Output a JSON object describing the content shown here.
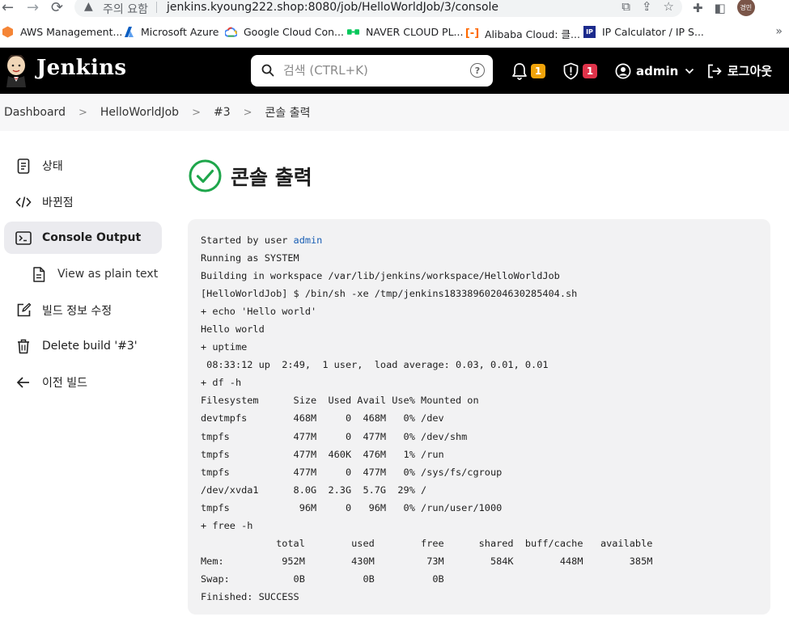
{
  "browser": {
    "security_status": "주의 요함",
    "url": "jenkins.kyoung222.shop:8080/job/HelloWorldJob/3/console",
    "profile_initials": "경민",
    "bookmarks": [
      {
        "label": "AWS Management...",
        "icon": "aws-cube-icon",
        "color": "#f58536"
      },
      {
        "label": "Microsoft Azure",
        "icon": "azure-icon",
        "color": "#0078d4"
      },
      {
        "label": "Google Cloud Con...",
        "icon": "google-cloud-icon",
        "color": "#4285f4"
      },
      {
        "label": "NAVER CLOUD PL...",
        "icon": "naver-cloud-icon",
        "color": "#03c75a"
      },
      {
        "label": "Alibaba Cloud: 클...",
        "icon": "alibaba-icon",
        "color": "#ff6a00"
      },
      {
        "label": "IP Calculator / IP S...",
        "icon": "ip-calculator-icon",
        "color": "#1b2a8c"
      }
    ],
    "more": "»"
  },
  "header": {
    "title": "Jenkins",
    "search_placeholder": "검색 (CTRL+K)",
    "notifications_count": "1",
    "security_count": "1",
    "user": "admin",
    "logout_label": "로그아웃",
    "colors": {
      "notification_badge": "#f0a30a",
      "security_badge": "#e0334a"
    }
  },
  "breadcrumb": [
    "Dashboard",
    "HelloWorldJob",
    "#3",
    "콘솔 출력"
  ],
  "sidebar": {
    "items": [
      {
        "label": "상태",
        "icon": "status-document-icon"
      },
      {
        "label": "바뀐점",
        "icon": "code-changes-icon"
      },
      {
        "label": "Console Output",
        "icon": "terminal-icon",
        "active": true
      },
      {
        "label": "View as plain text",
        "icon": "plain-text-document-icon",
        "sub": true
      },
      {
        "label": "빌드 정보 수정",
        "icon": "edit-icon"
      },
      {
        "label": "Delete build '#3'",
        "icon": "trash-icon"
      },
      {
        "label": "이전 빌드",
        "icon": "arrow-left-icon"
      }
    ]
  },
  "main": {
    "title": "콘솔 출력",
    "status_color": "#1ea64b",
    "console": {
      "started_prefix": "Started by user ",
      "started_user": "admin",
      "lines": [
        "Running as SYSTEM",
        "Building in workspace /var/lib/jenkins/workspace/HelloWorldJob",
        "[HelloWorldJob] $ /bin/sh -xe /tmp/jenkins1833896020463028540​4.sh",
        "+ echo 'Hello world'",
        "Hello world",
        "+ uptime",
        " 08:33:12 up  2:49,  1 user,  load average: 0.03, 0.01, 0.01",
        "+ df -h",
        "Filesystem      Size  Used Avail Use% Mounted on",
        "devtmpfs        468M     0  468M   0% /dev",
        "tmpfs           477M     0  477M   0% /dev/shm",
        "tmpfs           477M  460K  476M   1% /run",
        "tmpfs           477M     0  477M   0% /sys/fs/cgroup",
        "/dev/xvda1      8.0G  2.3G  5.7G  29% /",
        "tmpfs            96M     0   96M   0% /run/user/1000",
        "+ free -h",
        "             total        used        free      shared  buff/cache   available",
        "Mem:          952M        430M         73M        584K        448M        385M",
        "Swap:           0B          0B          0B",
        "Finished: SUCCESS"
      ]
    }
  }
}
